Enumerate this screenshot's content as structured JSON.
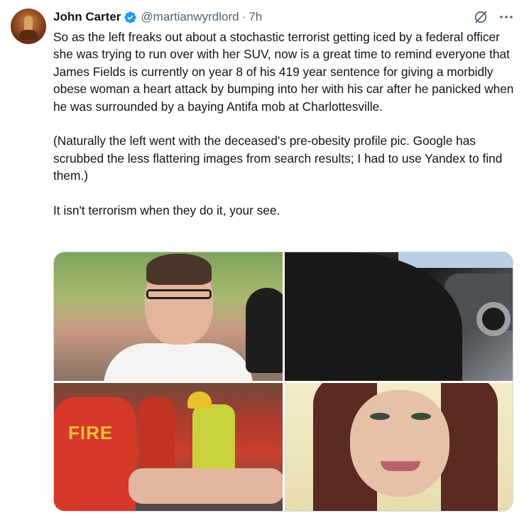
{
  "tweet": {
    "author_name": "John Carter",
    "handle": "@martianwyrdlord",
    "separator": "·",
    "time": "7h",
    "paragraphs": [
      "So as the left freaks out about a stochastic terrorist getting iced by a federal officer she was trying to run over with her SUV, now is a great time to remind everyone that James Fields is currently on year 8 of his 419 year sentence for giving a morbidly obese woman a heart attack by bumping into her with his car after he panicked when he was surrounded by a baying Antifa mob at Charlottesville.",
      "(Naturally the left went with the deceased's pre-obesity profile pic. Google has scrubbed the less flattering images from search results; I had to use Yandex to find them.)",
      "It isn't terrorism when they do it, your see."
    ],
    "photo_fire_text": "FIRE"
  },
  "icons": {
    "avatar": "avatar",
    "verified": "verified-badge-icon",
    "grok": "grok-icon",
    "more": "more-icon"
  },
  "colors": {
    "text": "#0f1419",
    "secondary": "#536471",
    "verified_blue": "#1d9bf0",
    "border": "#cfd9de"
  }
}
